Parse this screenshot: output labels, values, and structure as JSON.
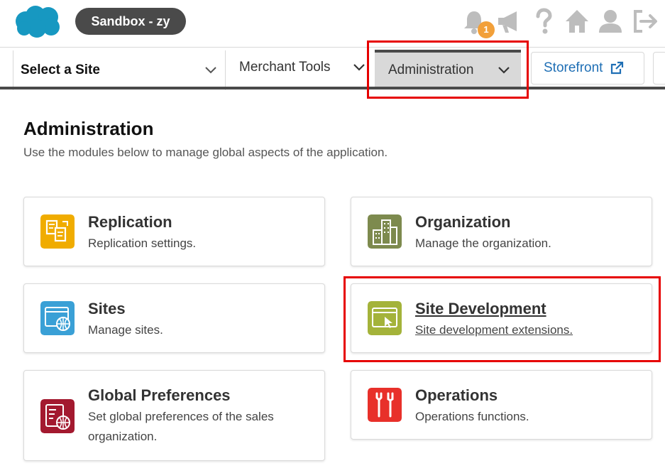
{
  "header": {
    "sandbox_label": "Sandbox - zy",
    "notification_count": "1"
  },
  "nav": {
    "select_site": "Select a Site",
    "merchant_tools": "Merchant Tools",
    "administration": "Administration",
    "storefront": "Storefront"
  },
  "page": {
    "title": "Administration",
    "subtitle": "Use the modules below to manage global aspects of the application."
  },
  "cards": [
    {
      "title": "Replication",
      "desc": "Replication settings.",
      "icon": "replication-icon",
      "color": "#f0ac00"
    },
    {
      "title": "Organization",
      "desc": "Manage the organization.",
      "icon": "organization-icon",
      "color": "#7d8a4e"
    },
    {
      "title": "Sites",
      "desc": "Manage sites.",
      "icon": "sites-icon",
      "color": "#3aa0d6"
    },
    {
      "title": "Site Development",
      "desc": "Site development extensions.",
      "icon": "site-development-icon",
      "color": "#a4b33a"
    },
    {
      "title": "Global Preferences",
      "desc": "Set global preferences of the sales organization.",
      "icon": "global-preferences-icon",
      "color": "#a3192f"
    },
    {
      "title": "Operations",
      "desc": "Operations functions.",
      "icon": "operations-icon",
      "color": "#e8302a"
    }
  ],
  "colors": {
    "highlight": "#e60000",
    "link": "#1f6fb5",
    "badge": "#f2a03a"
  }
}
